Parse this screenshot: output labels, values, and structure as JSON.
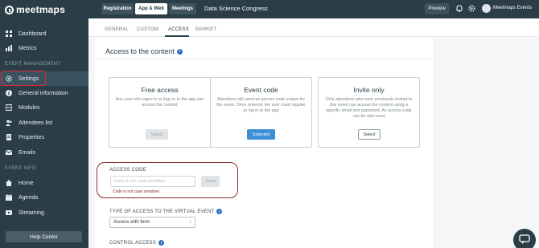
{
  "brand": {
    "name": "meetmaps"
  },
  "sidebar": {
    "items": [
      {
        "label": "Dashboard",
        "icon": "dashboard-icon"
      },
      {
        "label": "Metrics",
        "icon": "metrics-icon"
      }
    ],
    "sections": [
      {
        "title": "EVENT MANAGEMENT"
      },
      {
        "title": "EVENT INFO"
      }
    ],
    "management": [
      {
        "label": "Settings",
        "icon": "gear-icon"
      },
      {
        "label": "General information",
        "icon": "info-icon"
      },
      {
        "label": "Modules",
        "icon": "modules-icon"
      },
      {
        "label": "Attendees list",
        "icon": "users-icon"
      },
      {
        "label": "Properties",
        "icon": "properties-icon"
      },
      {
        "label": "Emails",
        "icon": "mail-icon"
      }
    ],
    "info": [
      {
        "label": "Home",
        "icon": "home-icon"
      },
      {
        "label": "Agenda",
        "icon": "agenda-icon"
      },
      {
        "label": "Streaming",
        "icon": "streaming-icon"
      }
    ],
    "help_label": "Help Center"
  },
  "topbar": {
    "tabs": [
      "Registration",
      "App & Web",
      "Meetings"
    ],
    "event_title": "Data Science Congress",
    "preview_label": "Preview",
    "user_name": "Meetmaps Events"
  },
  "tabs": [
    "GENERAL",
    "CUSTOM",
    "ACCESS",
    "MARKET"
  ],
  "content": {
    "title": "Access to the content",
    "options": [
      {
        "title": "Free access",
        "desc": "Any user who signs in or logs in to the app can access the content",
        "button": "Select"
      },
      {
        "title": "Event code",
        "desc": "Attendees will need an access code unique for the event. Once entered, the user must register or log in to the app",
        "button": "Selected"
      },
      {
        "title": "Invite only",
        "desc": "Only attendees who were previously invited to this event can access the content using a specific email and password. An access code can be also used",
        "button": "Select"
      }
    ],
    "access_code_label": "ACCESS CODE",
    "code_placeholder": "Code is not case sensitive",
    "save_label": "Save",
    "code_hint": "Code is not case sensitive",
    "type_label": "TYPE OF ACCESS TO THE VIRTUAL EVENT",
    "type_value": "Access with form",
    "control_label": "CONTROL ACCESS"
  },
  "colors": {
    "sidebar": "#2b3e48",
    "accent": "#3d8fd6",
    "highlight_red": "#e0263c"
  }
}
